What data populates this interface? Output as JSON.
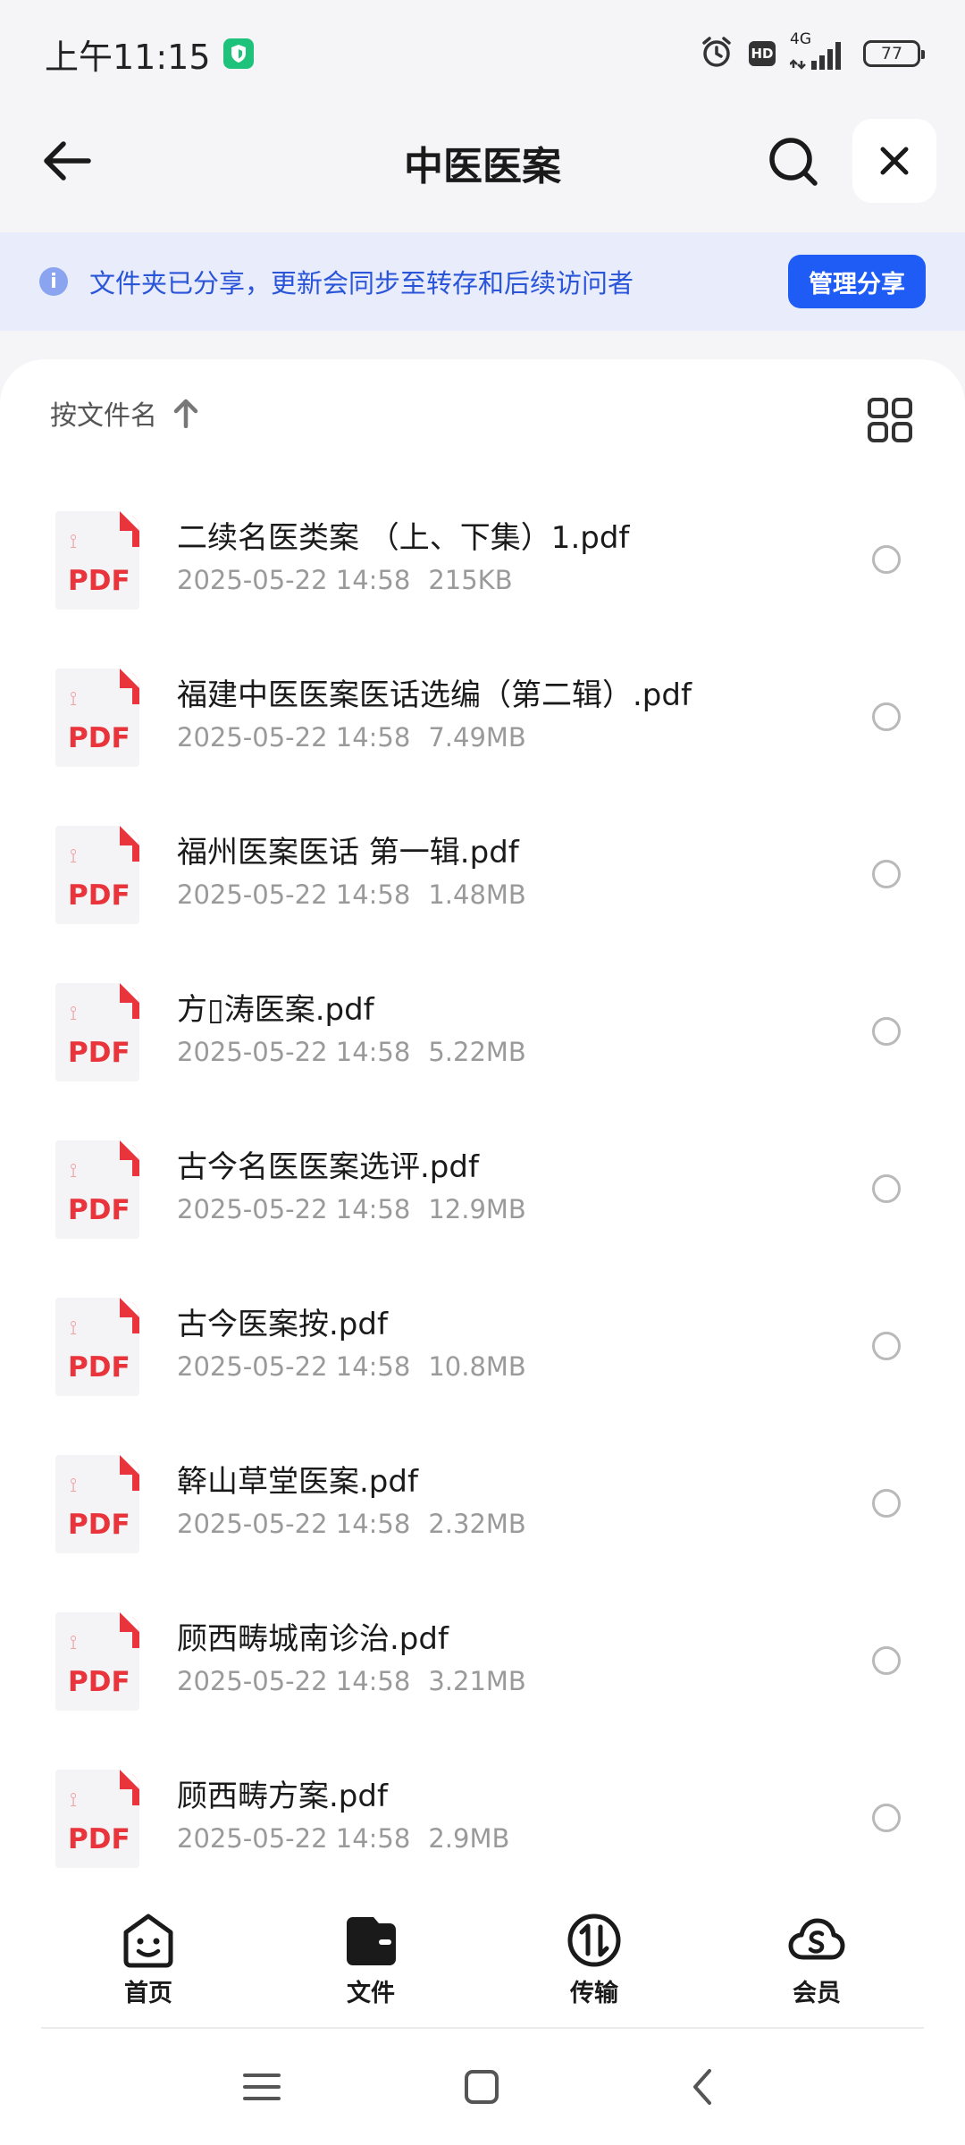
{
  "status_bar": {
    "time": "上午11:15",
    "hd": "HD",
    "network": "4G",
    "battery": "77"
  },
  "header": {
    "title": "中医医案"
  },
  "banner": {
    "text": "文件夹已分享，更新会同步至转存和后续访问者",
    "button_label": "管理分享"
  },
  "sort": {
    "label": "按文件名"
  },
  "pdf_icon_label": "PDF",
  "files": [
    {
      "name": "二续名医类案  （上、下集）1.pdf",
      "date": "2025-05-22 14:58",
      "size": "215KB"
    },
    {
      "name": "福建中医医案医话选编（第二辑）.pdf",
      "date": "2025-05-22 14:58",
      "size": "7.49MB"
    },
    {
      "name": "福州医案医话 第一辑.pdf",
      "date": "2025-05-22 14:58",
      "size": "1.48MB"
    },
    {
      "name": "方▯涛医案.pdf",
      "date": "2025-05-22 14:58",
      "size": "5.22MB"
    },
    {
      "name": "古今名医医案选评.pdf",
      "date": "2025-05-22 14:58",
      "size": "12.9MB"
    },
    {
      "name": "古今医案按.pdf",
      "date": "2025-05-22 14:58",
      "size": "10.8MB"
    },
    {
      "name": "簳山草堂医案.pdf",
      "date": "2025-05-22 14:58",
      "size": "2.32MB"
    },
    {
      "name": "顾西畴城南诊治.pdf",
      "date": "2025-05-22 14:58",
      "size": "3.21MB"
    },
    {
      "name": "顾西畴方案.pdf",
      "date": "2025-05-22 14:58",
      "size": "2.9MB"
    }
  ],
  "bottom_nav": [
    {
      "label": "首页"
    },
    {
      "label": "文件"
    },
    {
      "label": "传输"
    },
    {
      "label": "会员"
    }
  ],
  "colors": {
    "accent": "#1e5cf5",
    "banner_bg": "#e8ecfb",
    "pdf_red": "#e8343a"
  }
}
